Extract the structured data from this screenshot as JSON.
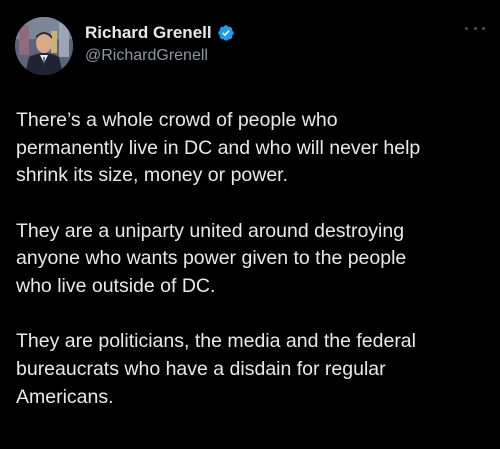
{
  "author": {
    "display_name": "Richard Grenell",
    "handle": "@RichardGrenell",
    "avatar_icon": "profile-photo",
    "verified_icon": "verified-badge-icon",
    "verified_color": "#1d9bf0"
  },
  "menu": {
    "icon": "more-options-icon"
  },
  "tweet": {
    "paragraphs": [
      "There’s a whole crowd of people who\npermanently live in DC and who will never help\nshrink its size, money or power.",
      "They are a uniparty united around destroying\nanyone who wants power given to the people\nwho live outside of DC.",
      "They are politicians, the media and the federal\nbureaucrats who have a disdain for regular\nAmericans."
    ]
  },
  "colors": {
    "background": "#000000",
    "text": "#e7e9ea",
    "secondary_text": "#8b98a5"
  }
}
